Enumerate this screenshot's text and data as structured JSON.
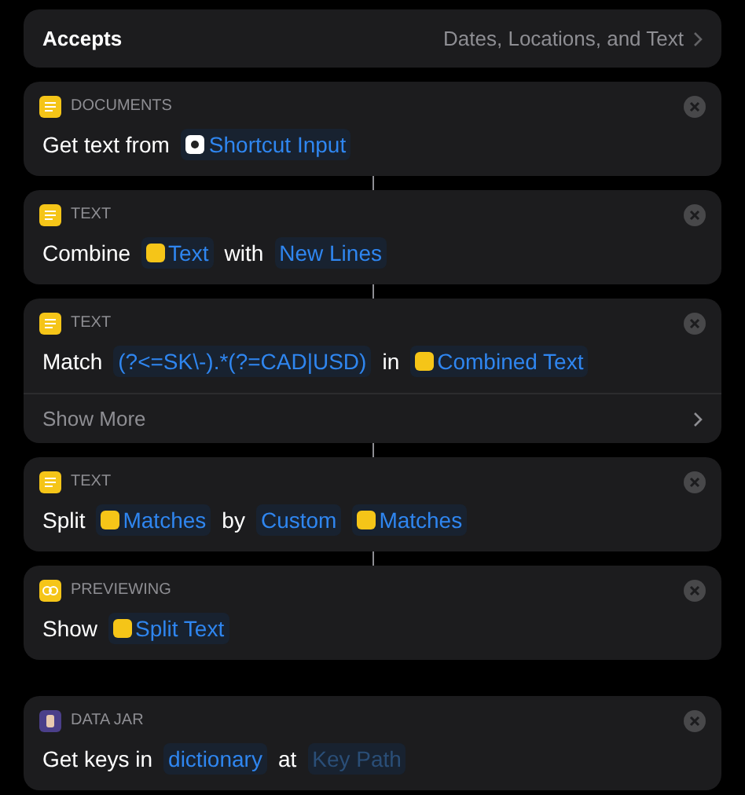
{
  "accepts": {
    "label": "Accepts",
    "value": "Dates, Locations, and Text"
  },
  "actions": [
    {
      "category": "DOCUMENTS",
      "kind": "doc",
      "connected_above": false,
      "parts": [
        {
          "kind": "text",
          "text": "Get text from"
        },
        {
          "kind": "input",
          "text": "Shortcut Input"
        }
      ]
    },
    {
      "category": "TEXT",
      "kind": "doc",
      "connected_above": true,
      "parts": [
        {
          "kind": "text",
          "text": "Combine"
        },
        {
          "kind": "variable",
          "text": "Text"
        },
        {
          "kind": "text",
          "text": "with"
        },
        {
          "kind": "token",
          "text": "New Lines"
        }
      ]
    },
    {
      "category": "TEXT",
      "kind": "doc",
      "connected_above": true,
      "show_more": "Show More",
      "parts": [
        {
          "kind": "text",
          "text": "Match"
        },
        {
          "kind": "token",
          "text": "(?<=SK\\-).*(?=CAD|USD)"
        },
        {
          "kind": "text",
          "text": "in"
        },
        {
          "kind": "variable",
          "text": "Combined Text"
        }
      ]
    },
    {
      "category": "TEXT",
      "kind": "doc",
      "connected_above": true,
      "parts": [
        {
          "kind": "text",
          "text": "Split"
        },
        {
          "kind": "variable",
          "text": "Matches"
        },
        {
          "kind": "text",
          "text": "by"
        },
        {
          "kind": "token",
          "text": "Custom"
        },
        {
          "kind": "variable",
          "text": "Matches"
        }
      ]
    },
    {
      "category": "PREVIEWING",
      "kind": "preview",
      "connected_above": true,
      "parts": [
        {
          "kind": "text",
          "text": "Show"
        },
        {
          "kind": "variable",
          "text": "Split Text"
        }
      ]
    },
    {
      "category": "DATA JAR",
      "kind": "jar",
      "connected_above": false,
      "parts": [
        {
          "kind": "text",
          "text": "Get keys in"
        },
        {
          "kind": "token",
          "text": "dictionary"
        },
        {
          "kind": "text",
          "text": "at"
        },
        {
          "kind": "placeholder",
          "text": "Key Path"
        }
      ]
    }
  ]
}
